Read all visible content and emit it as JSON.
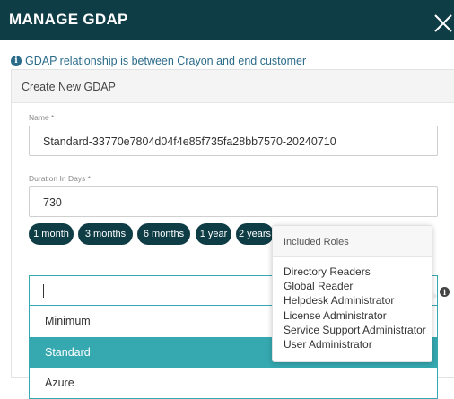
{
  "header": {
    "title": "MANAGE GDAP",
    "close_icon": "close-icon"
  },
  "info": {
    "icon": "info-icon",
    "text": "GDAP relationship is between Crayon and end customer"
  },
  "panel": {
    "title": "Create New GDAP"
  },
  "form": {
    "name": {
      "label": "Name *",
      "value": "Standard-33770e7804d04f4e85f735fa28bb7570-20240710"
    },
    "duration": {
      "label": "Duration In Days *",
      "value": "730"
    },
    "duration_presets": [
      "1 month",
      "3 months",
      "6 months",
      "1 year",
      "2 years"
    ],
    "template_select": {
      "value": "",
      "options": [
        "Minimum",
        "Standard",
        "Azure"
      ],
      "selected": "Standard"
    }
  },
  "roles_tooltip": {
    "title": "Included Roles",
    "roles": [
      "Directory Readers",
      "Global Reader",
      "Helpdesk Administrator",
      "License Administrator",
      "Service Support Administrator",
      "User Administrator"
    ]
  },
  "colors": {
    "header_bg": "#0f3d46",
    "accent": "#36a8b0",
    "info_text": "#2a6b8a",
    "pill_bg": "#0f3d46"
  }
}
